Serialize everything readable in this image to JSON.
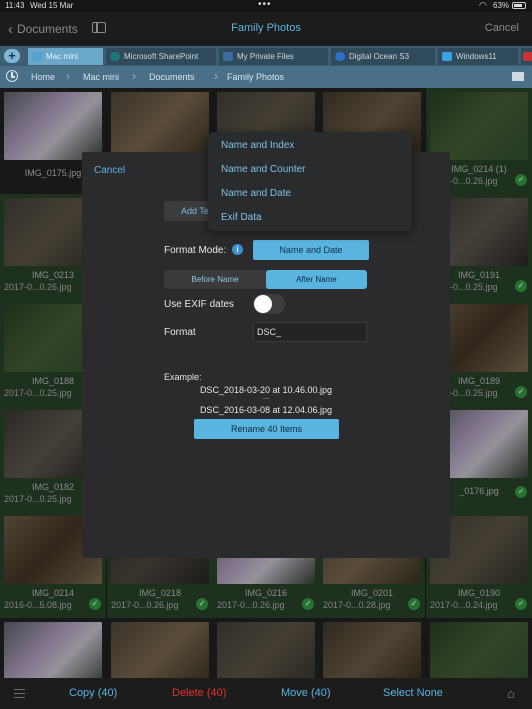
{
  "status_bar": {
    "time": "11:43",
    "date": "Wed 15 Mar",
    "battery": "63%"
  },
  "nav": {
    "back_label": "Documents",
    "title": "Family Photos",
    "cancel_label": "Cancel"
  },
  "tabs": [
    {
      "label": "Mac mini",
      "active": true,
      "icon": "monitor-icon"
    },
    {
      "label": "Microsoft SharePoint",
      "active": false,
      "icon": "sharepoint-icon"
    },
    {
      "label": "My Private Files",
      "active": false,
      "icon": "folder-icon"
    },
    {
      "label": "Digital Ocean S3",
      "active": false,
      "icon": "digital-ocean-icon"
    },
    {
      "label": "Windows11",
      "active": false,
      "icon": "windows-icon"
    }
  ],
  "breadcrumb": [
    "Home",
    "Mac mini",
    "Documents",
    "Family Photos"
  ],
  "grid": {
    "cells": [
      {
        "name": "IMG_0175.jpg",
        "date": "",
        "checked": false
      },
      {
        "name": "",
        "date": "",
        "checked": false
      },
      {
        "name": "",
        "date": "",
        "checked": false
      },
      {
        "name": "",
        "date": "",
        "checked": false
      },
      {
        "name": "IMG_0214 (1)",
        "date": "2017-0...0.26.jpg",
        "checked": true
      },
      {
        "name": "IMG_0213",
        "date": "2017-0...0.26.jpg",
        "checked": true
      },
      {
        "name": "",
        "date": "",
        "checked": false
      },
      {
        "name": "",
        "date": "",
        "checked": false
      },
      {
        "name": "",
        "date": "",
        "checked": false
      },
      {
        "name": "IMG_0191",
        "date": "2017-0...0.25.jpg",
        "checked": true
      },
      {
        "name": "IMG_0188",
        "date": "2017-0...0.25.jpg",
        "checked": true
      },
      {
        "name": "",
        "date": "",
        "checked": false
      },
      {
        "name": "",
        "date": "",
        "checked": false
      },
      {
        "name": "",
        "date": "",
        "checked": false
      },
      {
        "name": "IMG_0189",
        "date": "2017-0...0.25.jpg",
        "checked": true
      },
      {
        "name": "IMG_0182",
        "date": "2017-0...0.25.jpg",
        "checked": true
      },
      {
        "name": "",
        "date": "",
        "checked": false
      },
      {
        "name": "",
        "date": "",
        "checked": false
      },
      {
        "name": "",
        "date": "",
        "checked": false
      },
      {
        "name": "_0176.jpg",
        "date": "",
        "checked": true
      },
      {
        "name": "IMG_0214",
        "date": "2016-0...5.08.jpg",
        "checked": true
      },
      {
        "name": "IMG_0218",
        "date": "2017-0...0.26.jpg",
        "checked": true
      },
      {
        "name": "IMG_0216",
        "date": "2017-0...0.26.jpg",
        "checked": true
      },
      {
        "name": "IMG_0201",
        "date": "2017-0...0.28.jpg",
        "checked": true
      },
      {
        "name": "IMG_0190",
        "date": "2017-0...0.24.jpg",
        "checked": true
      },
      {
        "name": "",
        "date": "",
        "checked": false
      },
      {
        "name": "",
        "date": "",
        "checked": false
      },
      {
        "name": "",
        "date": "",
        "checked": false
      },
      {
        "name": "",
        "date": "",
        "checked": false
      },
      {
        "name": "",
        "date": "",
        "checked": false
      }
    ],
    "check_glyph": "✓"
  },
  "dialog": {
    "cancel_label": "Cancel",
    "add_tag_label": "Add Te",
    "format_mode_label": "Format Mode:",
    "format_mode_value": "Name and Date",
    "position_segments": [
      {
        "label": "Before Name",
        "selected": false
      },
      {
        "label": "After Name",
        "selected": true
      }
    ],
    "use_exif_label": "Use EXIF dates",
    "use_exif_on": false,
    "format_label": "Format",
    "format_value": "DSC_",
    "example_label": "Example:",
    "example_first": "DSC_2018-03-20 at 10.46.00.jpg",
    "example_ellipsis": "...",
    "example_last": "DSC_2016-03-08 at 12.04.06.jpg",
    "rename_label": "Rename 40 Items"
  },
  "format_menu": {
    "items": [
      "Name and Index",
      "Name and Counter",
      "Name and Date",
      "Exif Data"
    ]
  },
  "toolbar": {
    "copy_label": "Copy (40)",
    "delete_label": "Delete (40)",
    "move_label": "Move (40)",
    "select_none_label": "Select None"
  },
  "colors": {
    "accent": "#5ab4e0",
    "danger": "#e0332e",
    "check": "#38b24a",
    "tab_bar": "#3d5d70",
    "breadcrumb_bar": "#4a7088"
  }
}
